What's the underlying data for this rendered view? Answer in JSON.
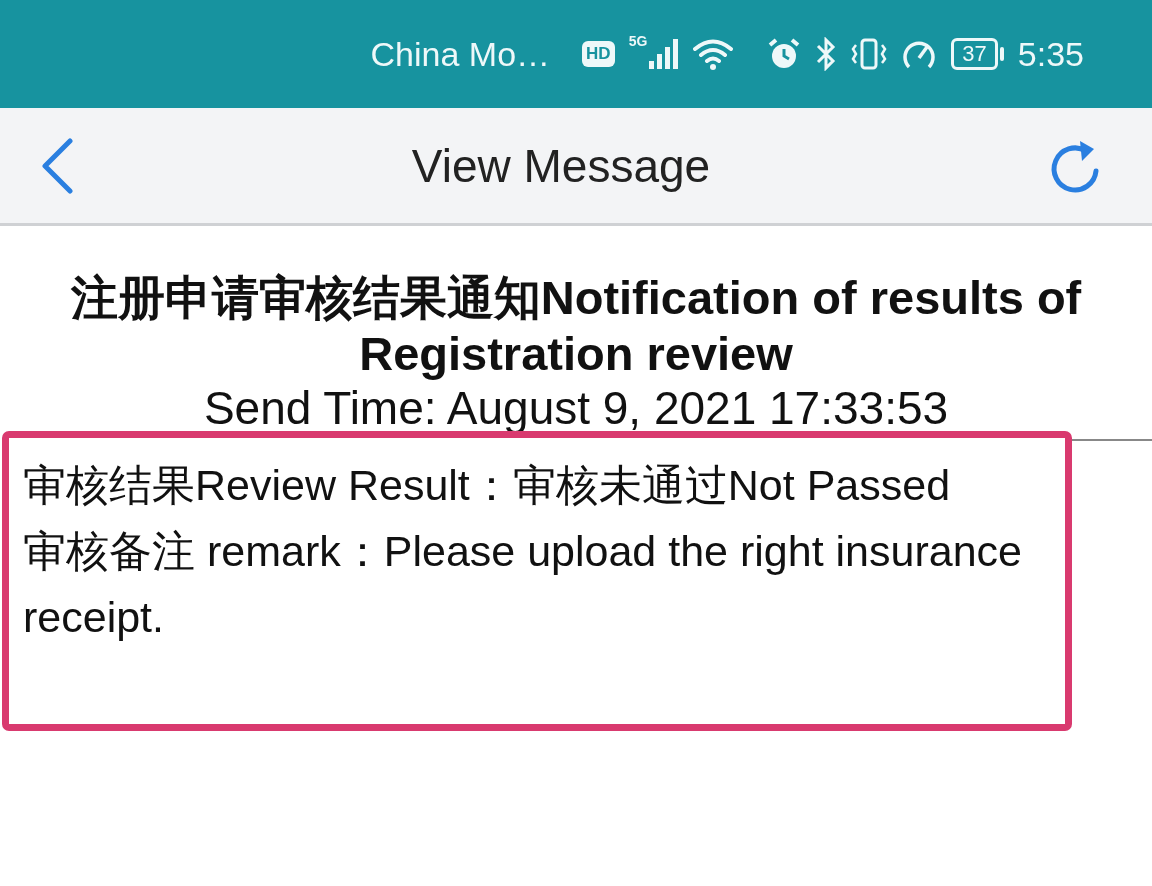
{
  "status_bar": {
    "carrier": "China Mo…",
    "hd": "HD",
    "network": "5G",
    "battery": "37",
    "time": "5:35"
  },
  "nav_bar": {
    "title": "View Message"
  },
  "message": {
    "title": "注册申请审核结果通知Notification of results of Registration review",
    "send_time": "Send Time: August 9, 2021 17:33:53",
    "lines": [
      "审核结果Review Result：审核未通过Not Passed",
      "审核备注 remark：Please upload the right insurance receipt."
    ]
  }
}
